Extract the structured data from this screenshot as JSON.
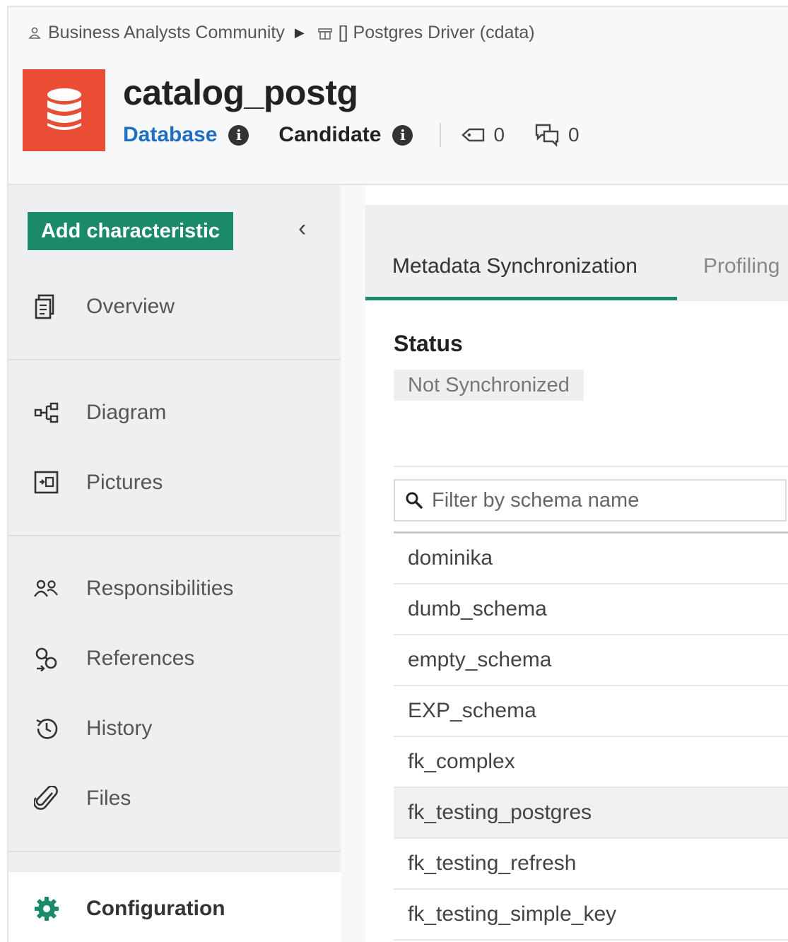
{
  "breadcrumb": {
    "community": "Business Analysts Community",
    "separator": "▶",
    "parent": "[] Postgres Driver (cdata)"
  },
  "asset": {
    "title": "catalog_postg",
    "type": "Database",
    "status": "Candidate",
    "tags_count": "0",
    "comments_count": "0",
    "icon_color": "#e94e34"
  },
  "sidebar": {
    "add_button": "Add characteristic",
    "collapse_glyph": "‹",
    "items": [
      {
        "label": "Overview",
        "icon": "overview-icon"
      },
      {
        "label": "Diagram",
        "icon": "diagram-icon"
      },
      {
        "label": "Pictures",
        "icon": "pictures-icon"
      },
      {
        "label": "Responsibilities",
        "icon": "people-icon"
      },
      {
        "label": "References",
        "icon": "references-icon"
      },
      {
        "label": "History",
        "icon": "history-icon"
      },
      {
        "label": "Files",
        "icon": "paperclip-icon"
      }
    ],
    "config_label": "Configuration"
  },
  "tabs": [
    {
      "label": "Metadata Synchronization",
      "active": true
    },
    {
      "label": "Profiling",
      "active": false
    }
  ],
  "status": {
    "label": "Status",
    "value": "Not Synchronized"
  },
  "filter": {
    "placeholder": "Filter by schema name"
  },
  "schemas": [
    "dominika",
    "dumb_schema",
    "empty_schema",
    "EXP_schema",
    "fk_complex",
    "fk_testing_postgres",
    "fk_testing_refresh",
    "fk_testing_simple_key"
  ],
  "selected_schema": "fk_testing_postgres",
  "colors": {
    "accent": "#1a8a6a",
    "link": "#1e6fc4"
  }
}
